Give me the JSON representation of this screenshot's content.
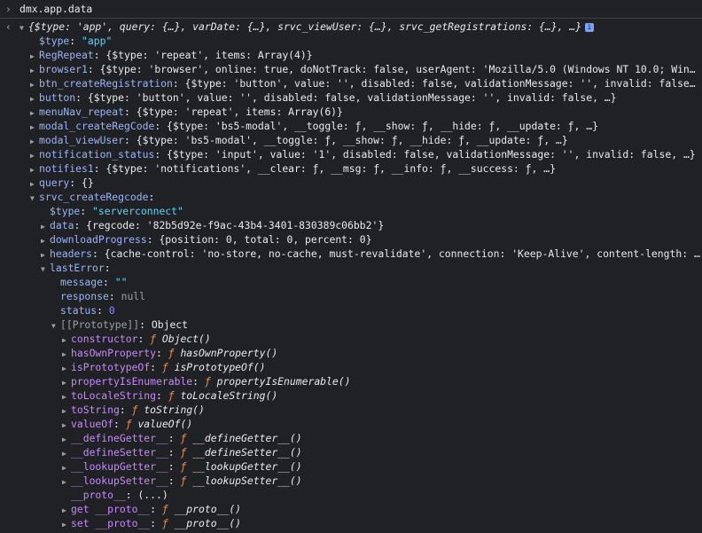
{
  "input": {
    "prompt": "›",
    "command": "dmx.app.data"
  },
  "output": {
    "arrow": "‹"
  },
  "summary": "{$type: 'app', query: {…}, varDate: {…}, srvc_viewUser: {…}, srvc_getRegistrations: {…}, …}",
  "info_icon": "i",
  "lines": [
    {
      "indent": 0,
      "tri": "▼",
      "key": "",
      "text": ""
    },
    {
      "indent": 1,
      "tri": "",
      "key": "$type",
      "sep": ": ",
      "val": "\"app\"",
      "vtype": "s"
    },
    {
      "indent": 1,
      "tri": "▶",
      "key": "RegRepeat",
      "sep": ": ",
      "val": "{$type: 'repeat', items: Array(4)}",
      "vtype": "kd"
    },
    {
      "indent": 1,
      "tri": "▶",
      "key": "browser1",
      "sep": ": ",
      "val": "{$type: 'browser', online: true, doNotTrack: false, userAgent: 'Mozilla/5.0 (Windows NT 10.0; Win64;",
      "vtype": "kd"
    },
    {
      "indent": 1,
      "tri": "▶",
      "key": "btn_createRegistration",
      "sep": ": ",
      "val": "{$type: 'button', value: '', disabled: false, validationMessage: '', invalid: false, …",
      "vtype": "kd"
    },
    {
      "indent": 1,
      "tri": "▶",
      "key": "button",
      "sep": ": ",
      "val": "{$type: 'button', value: '', disabled: false, validationMessage: '', invalid: false, …}",
      "vtype": "kd"
    },
    {
      "indent": 1,
      "tri": "▶",
      "key": "menuNav_repeat",
      "sep": ": ",
      "val": "{$type: 'repeat', items: Array(6)}",
      "vtype": "kd"
    },
    {
      "indent": 1,
      "tri": "▶",
      "key": "modal_createRegCode",
      "sep": ": ",
      "val": "{$type: 'bs5-modal', __toggle: ƒ, __show: ƒ, __hide: ƒ, __update: ƒ, …}",
      "vtype": "kd"
    },
    {
      "indent": 1,
      "tri": "▶",
      "key": "modal_viewUser",
      "sep": ": ",
      "val": "{$type: 'bs5-modal', __toggle: ƒ, __show: ƒ, __hide: ƒ, __update: ƒ, …}",
      "vtype": "kd"
    },
    {
      "indent": 1,
      "tri": "▶",
      "key": "notification_status",
      "sep": ": ",
      "val": "{$type: 'input', value: '1', disabled: false, validationMessage: '', invalid: false, …}",
      "vtype": "kd"
    },
    {
      "indent": 1,
      "tri": "▶",
      "key": "notifies1",
      "sep": ": ",
      "val": "{$type: 'notifications', __clear: ƒ, __msg: ƒ, __info: ƒ, __success: ƒ, …}",
      "vtype": "kd"
    },
    {
      "indent": 1,
      "tri": "▶",
      "key": "query",
      "sep": ": ",
      "val": "{}",
      "vtype": "kd"
    },
    {
      "indent": 1,
      "tri": "▼",
      "key": "srvc_createRegcode",
      "sep": ":",
      "val": "",
      "vtype": "kd"
    },
    {
      "indent": 2,
      "tri": "",
      "key": "$type",
      "sep": ": ",
      "val": "\"serverconnect\"",
      "vtype": "s"
    },
    {
      "indent": 2,
      "tri": "▶",
      "key": "data",
      "sep": ": ",
      "val": "{regcode: '82b5d92e-f9ac-43b4-3401-830389c06bb2'}",
      "vtype": "kd"
    },
    {
      "indent": 2,
      "tri": "▶",
      "key": "downloadProgress",
      "sep": ": ",
      "val": "{position: 0, total: 0, percent: 0}",
      "vtype": "kd"
    },
    {
      "indent": 2,
      "tri": "▶",
      "key": "headers",
      "sep": ": ",
      "val": "{cache-control: 'no-store, no-cache, must-revalidate', connection: 'Keep-Alive', content-length: '5",
      "vtype": "kd"
    },
    {
      "indent": 2,
      "tri": "▼",
      "key": "lastError",
      "sep": ":",
      "val": "",
      "vtype": "kd"
    },
    {
      "indent": 3,
      "tri": "",
      "key": "message",
      "sep": ": ",
      "val": "\"\"",
      "vtype": "s"
    },
    {
      "indent": 3,
      "tri": "",
      "key": "response",
      "sep": ": ",
      "val": "null",
      "vtype": "g"
    },
    {
      "indent": 3,
      "tri": "",
      "key": "status",
      "sep": ": ",
      "val": "0",
      "vtype": "n"
    },
    {
      "indent": 3,
      "tri": "▼",
      "key": "[[Prototype]]",
      "sep": ": ",
      "val": "Object",
      "vtype": "kd",
      "kclass": "g"
    },
    {
      "indent": 4,
      "tri": "▶",
      "key": "constructor",
      "sep": ": ",
      "f": "ƒ ",
      "val": "Object()",
      "vtype": "fn",
      "kclass": "k2"
    },
    {
      "indent": 4,
      "tri": "▶",
      "key": "hasOwnProperty",
      "sep": ": ",
      "f": "ƒ ",
      "val": "hasOwnProperty()",
      "vtype": "fn",
      "kclass": "k2"
    },
    {
      "indent": 4,
      "tri": "▶",
      "key": "isPrototypeOf",
      "sep": ": ",
      "f": "ƒ ",
      "val": "isPrototypeOf()",
      "vtype": "fn",
      "kclass": "k2"
    },
    {
      "indent": 4,
      "tri": "▶",
      "key": "propertyIsEnumerable",
      "sep": ": ",
      "f": "ƒ ",
      "val": "propertyIsEnumerable()",
      "vtype": "fn",
      "kclass": "k2"
    },
    {
      "indent": 4,
      "tri": "▶",
      "key": "toLocaleString",
      "sep": ": ",
      "f": "ƒ ",
      "val": "toLocaleString()",
      "vtype": "fn",
      "kclass": "k2"
    },
    {
      "indent": 4,
      "tri": "▶",
      "key": "toString",
      "sep": ": ",
      "f": "ƒ ",
      "val": "toString()",
      "vtype": "fn",
      "kclass": "k2"
    },
    {
      "indent": 4,
      "tri": "▶",
      "key": "valueOf",
      "sep": ": ",
      "f": "ƒ ",
      "val": "valueOf()",
      "vtype": "fn",
      "kclass": "k2"
    },
    {
      "indent": 4,
      "tri": "▶",
      "key": "__defineGetter__",
      "sep": ": ",
      "f": "ƒ ",
      "val": "__defineGetter__()",
      "vtype": "fn",
      "kclass": "k2"
    },
    {
      "indent": 4,
      "tri": "▶",
      "key": "__defineSetter__",
      "sep": ": ",
      "f": "ƒ ",
      "val": "__defineSetter__()",
      "vtype": "fn",
      "kclass": "k2"
    },
    {
      "indent": 4,
      "tri": "▶",
      "key": "__lookupGetter__",
      "sep": ": ",
      "f": "ƒ ",
      "val": "__lookupGetter__()",
      "vtype": "fn",
      "kclass": "k2"
    },
    {
      "indent": 4,
      "tri": "▶",
      "key": "__lookupSetter__",
      "sep": ": ",
      "f": "ƒ ",
      "val": "__lookupSetter__()",
      "vtype": "fn",
      "kclass": "k2"
    },
    {
      "indent": 4,
      "tri": "",
      "key": "__proto__",
      "sep": ": ",
      "val": "(...)",
      "vtype": "kd",
      "kclass": "k2"
    },
    {
      "indent": 4,
      "tri": "▶",
      "key": "get __proto__",
      "sep": ": ",
      "f": "ƒ ",
      "val": "__proto__()",
      "vtype": "fn",
      "kclass": "k2"
    },
    {
      "indent": 4,
      "tri": "▶",
      "key": "set __proto__",
      "sep": ": ",
      "f": "ƒ ",
      "val": "__proto__()",
      "vtype": "fn",
      "kclass": "k2"
    }
  ]
}
